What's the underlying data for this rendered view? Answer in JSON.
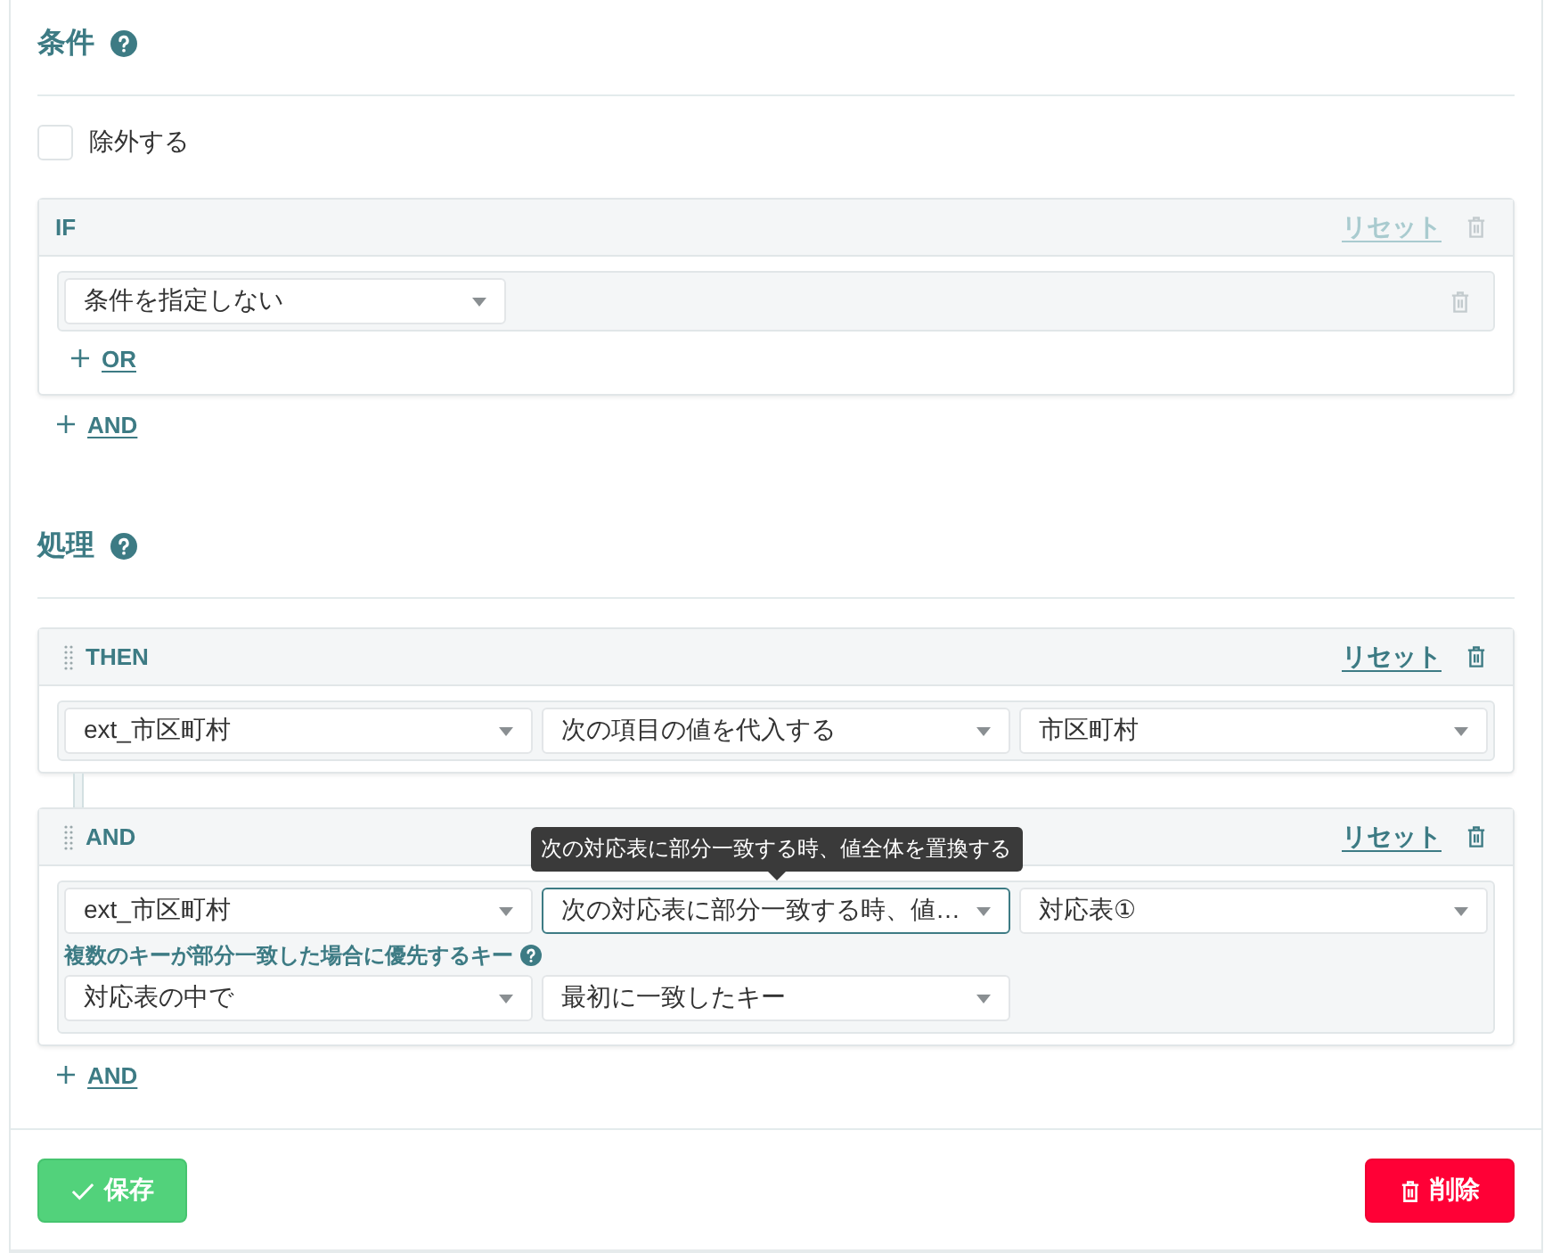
{
  "sections": [
    {
      "title": "条件",
      "exclude": {
        "label": "除外する",
        "checked": false
      },
      "blocks": [
        {
          "label": "IF",
          "draggable": false,
          "reset": {
            "label": "リセット",
            "disabled": true
          },
          "delete_disabled": true,
          "rows": [
            {
              "fields": [
                {
                  "value": "条件を指定しない",
                  "focused": false
                }
              ],
              "delete_disabled": true
            }
          ],
          "add_or": {
            "label": "OR"
          }
        }
      ],
      "add_and": {
        "label": "AND"
      }
    },
    {
      "title": "処理",
      "blocks": [
        {
          "label": "THEN",
          "draggable": true,
          "reset": {
            "label": "リセット",
            "disabled": false
          },
          "delete_disabled": false,
          "rows": [
            {
              "fields": [
                {
                  "value": "ext_市区町村",
                  "focused": false
                },
                {
                  "value": "次の項目の値を代入する",
                  "focused": false
                },
                {
                  "value": "市区町村",
                  "focused": false
                }
              ]
            }
          ]
        },
        {
          "label": "AND",
          "draggable": true,
          "reset": {
            "label": "リセット",
            "disabled": false
          },
          "delete_disabled": false,
          "rows": [
            {
              "fields": [
                {
                  "value": "ext_市区町村",
                  "focused": false
                },
                {
                  "value": "次の対応表に部分一致する時、値…",
                  "focused": true,
                  "tooltip": "次の対応表に部分一致する時、値全体を置換する"
                },
                {
                  "value": "対応表①",
                  "focused": false
                }
              ],
              "priority": {
                "label": "複数のキーが部分一致した場合に優先するキー",
                "fields": [
                  {
                    "value": "対応表の中で",
                    "focused": false
                  },
                  {
                    "value": "最初に一致したキー",
                    "focused": false
                  }
                ]
              }
            }
          ]
        }
      ],
      "add_and": {
        "label": "AND"
      }
    }
  ],
  "footer": {
    "save": {
      "label": "保存"
    },
    "delete": {
      "label": "削除"
    }
  }
}
